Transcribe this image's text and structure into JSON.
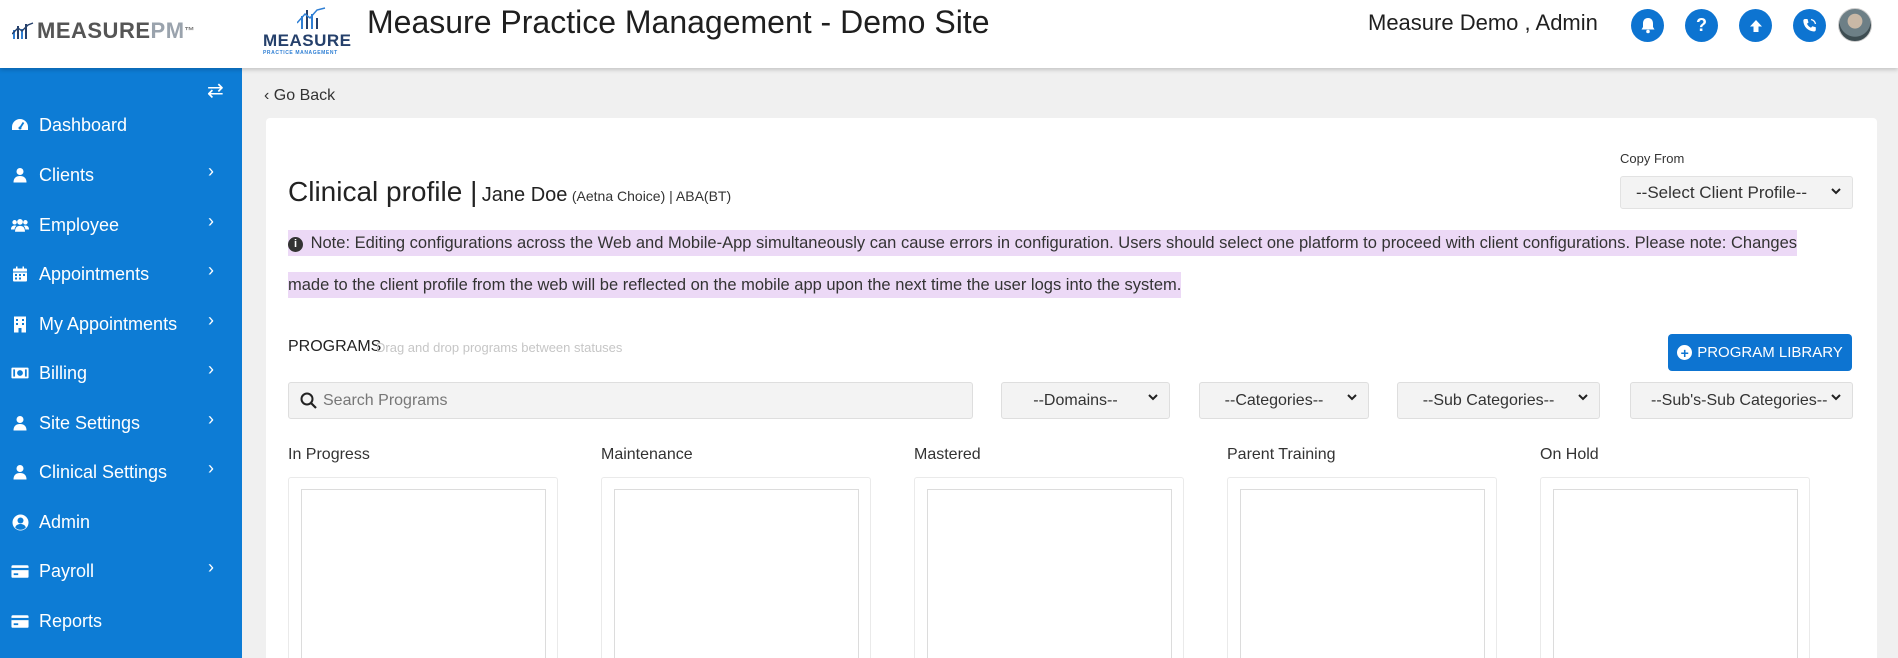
{
  "header": {
    "brand_main": "MEASURE",
    "brand_suffix": "PM",
    "brand_tm": "™",
    "logo_word": "MEASURE",
    "logo_sub": "PRACTICE MANAGEMENT",
    "site_title": "Measure Practice Management - Demo Site",
    "user_name": "Measure Demo , Admin",
    "icons": [
      "bell-icon",
      "help-icon",
      "upload-icon",
      "phone-icon"
    ]
  },
  "sidebar": {
    "items": [
      {
        "label": "Dashboard",
        "icon": "dashboard-icon",
        "has_submenu": false
      },
      {
        "label": "Clients",
        "icon": "user-icon",
        "has_submenu": true
      },
      {
        "label": "Employee",
        "icon": "users-icon",
        "has_submenu": true
      },
      {
        "label": "Appointments",
        "icon": "calendar-icon",
        "has_submenu": true
      },
      {
        "label": "My Appointments",
        "icon": "building-icon",
        "has_submenu": true
      },
      {
        "label": "Billing",
        "icon": "money-icon",
        "has_submenu": true
      },
      {
        "label": "Site Settings",
        "icon": "user-icon",
        "has_submenu": true
      },
      {
        "label": "Clinical Settings",
        "icon": "user-icon",
        "has_submenu": true
      },
      {
        "label": "Admin",
        "icon": "user-circle-icon",
        "has_submenu": false
      },
      {
        "label": "Payroll",
        "icon": "credit-card-icon",
        "has_submenu": true
      },
      {
        "label": "Reports",
        "icon": "credit-card-icon",
        "has_submenu": false
      }
    ]
  },
  "main": {
    "go_back": "Go Back",
    "copy_from_label": "Copy From",
    "copy_from_value": "--Select Client Profile--",
    "profile_title": "Clinical profile |",
    "client_name": "Jane Doe",
    "client_detail": "(Aetna Choice) | ABA(BT)",
    "note_line1": "Note: Editing configurations across the Web and Mobile-App simultaneously can cause errors in configuration. Users should select one platform to proceed with client configurations. Please note: Changes",
    "note_line2": "made to the client profile from the web will be reflected on the mobile app upon the next time the user logs into the system.",
    "programs_label": "PROGRAMS",
    "programs_hint": "Drag and drop programs between statuses",
    "library_button": "PROGRAM LIBRARY",
    "search_placeholder": "Search Programs",
    "filters": [
      "--Domains--",
      "--Categories--",
      "--Sub Categories--",
      "--Sub's-Sub Categories--"
    ],
    "columns": [
      "In Progress",
      "Maintenance",
      "Mastered",
      "Parent Training",
      "On Hold"
    ]
  },
  "colors": {
    "sidebar": "#0d7cd5",
    "accent": "#0d74d1",
    "note_highlight": "#ecd9f6"
  }
}
